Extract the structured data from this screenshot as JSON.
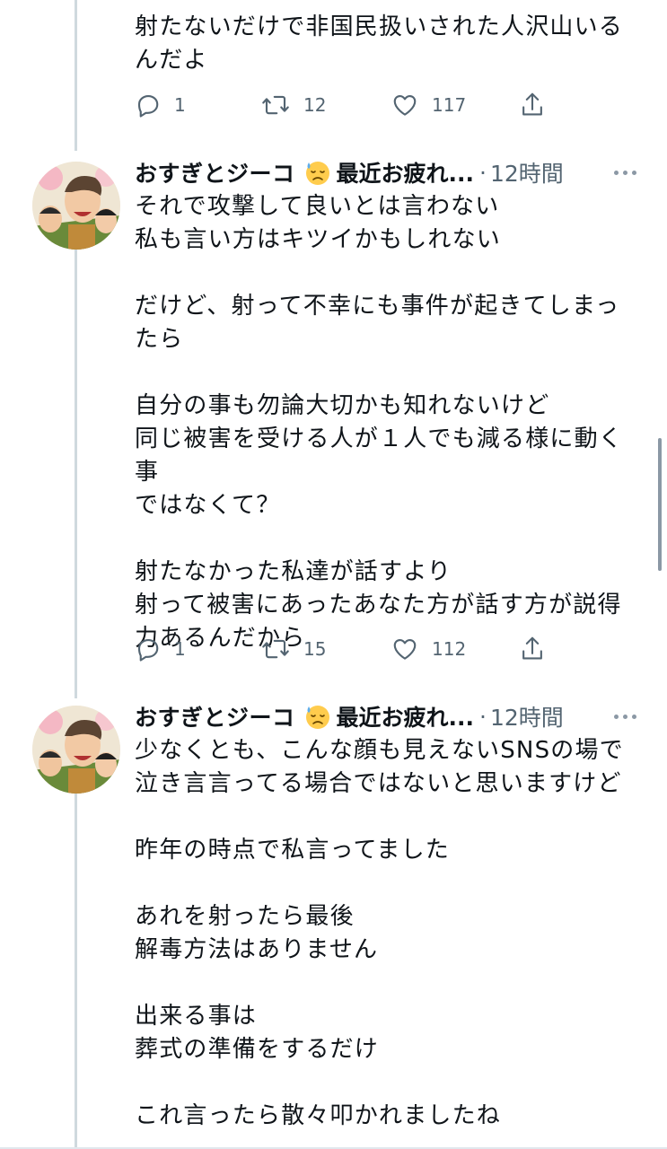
{
  "tweets": [
    {
      "text": "射たないだけで非国民扱いされた人沢山いる\nんだよ",
      "reply_count": "1",
      "retweet_count": "12",
      "like_count": "117"
    },
    {
      "author": "おすぎとジーコ",
      "status": "最近お疲れ...",
      "separator": "·",
      "time": "12時間",
      "paragraphs": [
        "それで攻撃して良いとは言わない\n私も言い方はキツイかもしれない",
        "だけど、射って不幸にも事件が起きてしまっ\nたら",
        "自分の事も勿論大切かも知れないけど\n同じ被害を受ける人が１人でも減る様に動く事\nではなくて？",
        "射たなかった私達が話すより\n射って被害にあったあなた方が話す方が説得\n力あるんだから"
      ],
      "reply_count": "1",
      "retweet_count": "15",
      "like_count": "112"
    },
    {
      "author": "おすぎとジーコ",
      "status": "最近お疲れ...",
      "separator": "·",
      "time": "12時間",
      "paragraphs": [
        "少なくとも、こんな顔も見えないSNSの場で\n泣き言言ってる場合ではないと思いますけど",
        "昨年の時点で私言ってました",
        "あれを射ったら最後\n解毒方法はありません",
        "出来る事は\n葬式の準備をするだけ",
        "これ言ったら散々叩かれましたね"
      ]
    }
  ],
  "icons": {
    "reply": "reply-icon",
    "retweet": "retweet-icon",
    "like": "like-icon",
    "share": "share-icon",
    "more": "more-icon",
    "emoji": "downcast-sweat-emoji"
  },
  "colors": {
    "text": "#0f1419",
    "secondary": "#536471",
    "thread_line": "#cfd9de"
  }
}
